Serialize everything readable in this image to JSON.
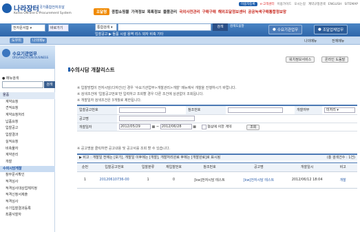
{
  "header": {
    "logo_title": "나라장터",
    "logo_subtitle": "국가종합전자조달",
    "logo_eng": "Korea ON-line E-Procurement System",
    "util_links": [
      "이용자등록",
      "e-고객센터",
      "이용가이드",
      "오시는길",
      "계약규정검색",
      "ENGLISH",
      "SITEMAP"
    ],
    "gnb": [
      "조달청",
      "종합쇼핑몰",
      "가격정보",
      "목록정보",
      "물품관리",
      "국외사전관리",
      "구매구매",
      "해외조달정보센터",
      "공공녹색구매통합정보망"
    ]
  },
  "search": {
    "doc_type": "전자문서함",
    "doc_type_btn": "바로가기",
    "integrated_label": "통합검색",
    "search_btn": "검색",
    "detail_btn": "검색도움말",
    "ticker": "입찰공고 ▶ 들품 시설 용역 리스 외자 비축 기타",
    "user_btn": "수요기관업무",
    "procure_btn": "조달업체업무"
  },
  "nav": {
    "tab1": "도우미",
    "tab2": "나의메뉴",
    "right1": "나의메뉴",
    "right2": "전체메뉴"
  },
  "lnb": {
    "title": "수요기관업무",
    "subtitle": "ORGANIZATION BUSINESS",
    "menu_search_label": "메뉴검색",
    "menu_search_btn": "검색",
    "items": [
      {
        "label": "물품",
        "type": "grp"
      },
      {
        "label": "계약요청",
        "type": "sub"
      },
      {
        "label": "견적요청",
        "type": "sub"
      },
      {
        "label": "계약요청처리",
        "type": "sub"
      },
      {
        "label": "납품요청",
        "type": "sub"
      },
      {
        "label": "입찰공고",
        "type": "sub"
      },
      {
        "label": "입찰결과",
        "type": "sub"
      },
      {
        "label": "실적요청",
        "type": "sub"
      },
      {
        "label": "비축물자",
        "type": "sub"
      },
      {
        "label": "계약관리",
        "type": "sub"
      },
      {
        "label": "개찰",
        "type": "sub"
      },
      {
        "label": "수의시담게찰",
        "type": "sel2"
      },
      {
        "label": "참부문서확인",
        "type": "sub"
      },
      {
        "label": "적격심사",
        "type": "sub"
      },
      {
        "label": "적격심사대상업체지정",
        "type": "sub"
      },
      {
        "label": "적격신청서제출",
        "type": "sub"
      },
      {
        "label": "적격심사",
        "type": "sub"
      },
      {
        "label": "수기입찰결과등록",
        "type": "sub"
      },
      {
        "label": "최종낙찰자",
        "type": "sub"
      }
    ]
  },
  "content": {
    "top_btn1": "워치정보서비스",
    "top_btn2": "온라인 도움말",
    "title": "수의시담 개찰리스트",
    "guides": [
      "※ 입찰방법이 전자시담(다자간)인 경우 '수요기관업무>개찰관리>개찰' 메뉴에서 개찰을 진행하시기 바랍니다.",
      "※ 검색조건에 '입찰공고번호'만 입력하고 조회할 경우 다른 조건에 상관없이 조회됩니다.",
      "※ 개찰일자 검색조건은 3개월로 제한됩니다."
    ],
    "form": {
      "bid_no_label": "입찰공고번호",
      "ref_no_label": "참조번호",
      "open_label": "개찰여부",
      "open_value": "미처리",
      "bid_name_label": "공고명",
      "date_label": "개찰일자",
      "date_from": "2012/05/29",
      "date_to": "2012/06/28",
      "check_label": "협상에 의한 계약",
      "search_btn": "조회"
    },
    "note": "※ 공고명을 클릭하면 공고내용 및 공고서를 조회 할 수 있습니다.",
    "result_bar": "▶ 비고 : 개찰일 전에는 [보기], 개찰일 이후에는 [개찰], 개찰처리완료 후에는 [개찰완료]로 표시됨",
    "result_count": "(총 검색건수 : 1건)",
    "columns": [
      "순번",
      "입찰공고번호",
      "입찰분류",
      "재입찰번호",
      "참조번호",
      "공고명",
      "개찰일시",
      "비고"
    ],
    "rows": [
      [
        "1",
        "20120610736-00",
        "1",
        "0",
        "[kw]전자시담 테스트",
        "[kw]전자시담 테스트",
        "2012/06/12 18:04",
        "개찰"
      ]
    ]
  }
}
